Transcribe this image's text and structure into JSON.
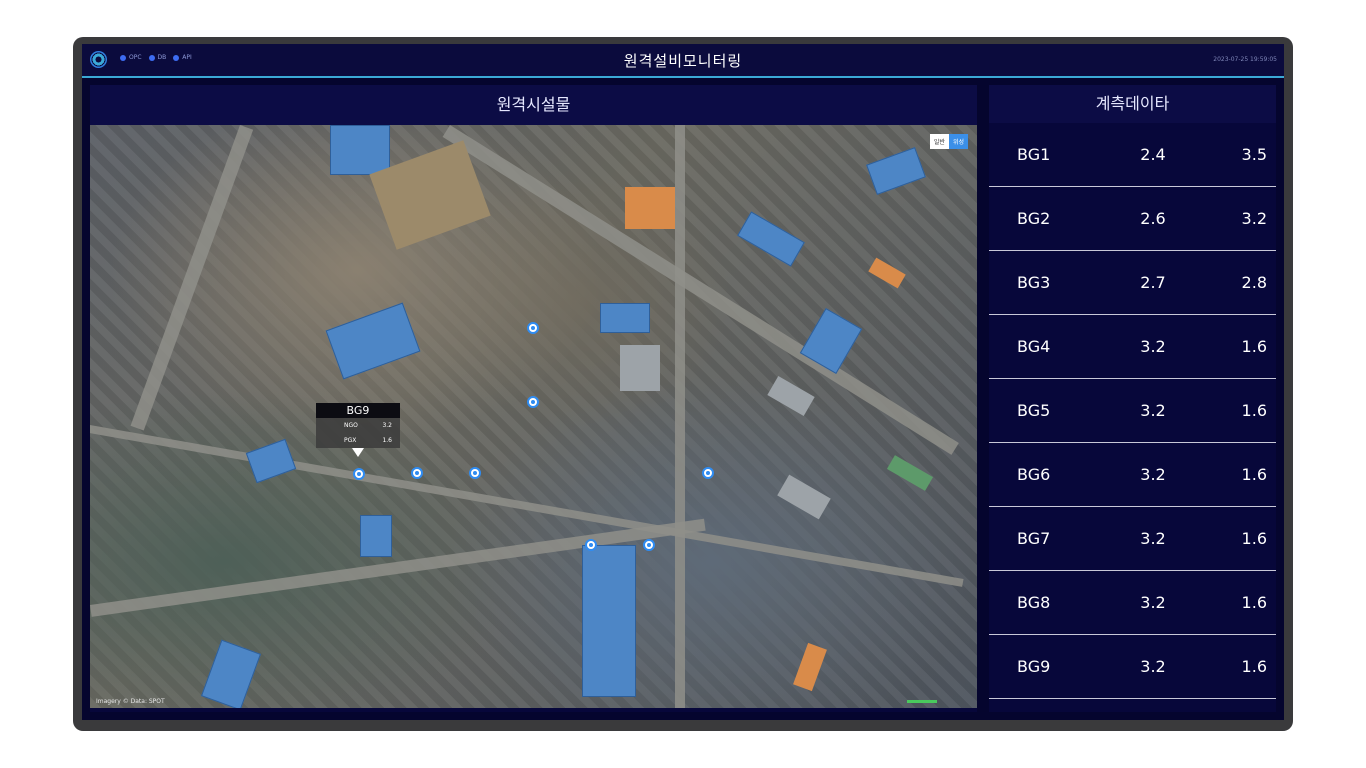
{
  "header": {
    "status": [
      {
        "label": "OPC",
        "color": "#3d6cf2"
      },
      {
        "label": "DB",
        "color": "#3d6cf2"
      },
      {
        "label": "API",
        "color": "#3d6cf2"
      }
    ],
    "title": "원격설비모니터링",
    "datetime": "2023-07-25 19:59:05"
  },
  "map_panel": {
    "title": "원격시설물",
    "toggle": {
      "normal": "일반",
      "satellite": "위성"
    },
    "popup": {
      "name": "BG9",
      "rows": [
        {
          "label": "NGO",
          "value": "3.2"
        },
        {
          "label": "PGX",
          "value": "1.6"
        }
      ]
    },
    "copyright": "Imagery © Data: SPOT"
  },
  "data_panel": {
    "title": "계측데이타",
    "rows": [
      {
        "name": "BG1",
        "v1": "2.4",
        "v2": "3.5"
      },
      {
        "name": "BG2",
        "v1": "2.6",
        "v2": "3.2"
      },
      {
        "name": "BG3",
        "v1": "2.7",
        "v2": "2.8"
      },
      {
        "name": "BG4",
        "v1": "3.2",
        "v2": "1.6"
      },
      {
        "name": "BG5",
        "v1": "3.2",
        "v2": "1.6"
      },
      {
        "name": "BG6",
        "v1": "3.2",
        "v2": "1.6"
      },
      {
        "name": "BG7",
        "v1": "3.2",
        "v2": "1.6"
      },
      {
        "name": "BG8",
        "v1": "3.2",
        "v2": "1.6"
      },
      {
        "name": "BG9",
        "v1": "3.2",
        "v2": "1.6"
      }
    ]
  },
  "colors": {
    "accent": "#3ba9d6",
    "marker": "#2f8cf2",
    "background": "#05052e"
  }
}
